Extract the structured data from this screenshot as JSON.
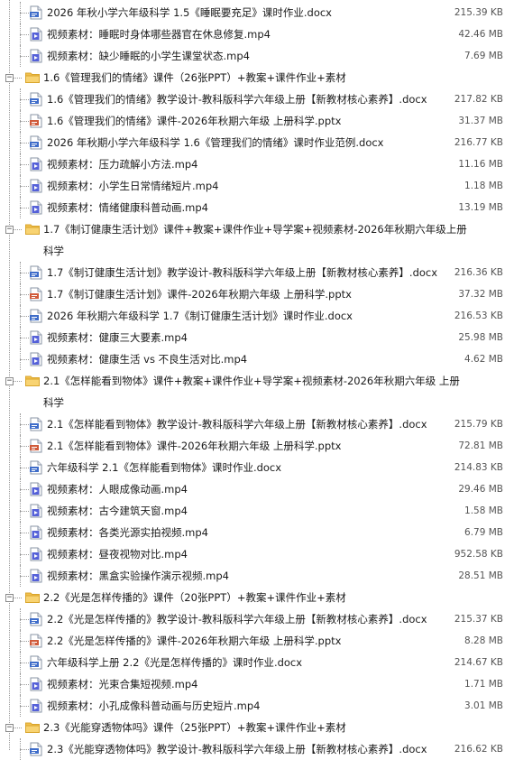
{
  "colors": {
    "doc": "#3f6dc9",
    "video": "#5561d8",
    "ppt": "#d05a3a",
    "folder": "#f2c14e"
  },
  "rows": [
    {
      "kind": "file",
      "icon": "doc-icon",
      "name": "2026 年秋小学六年级科学 1.5《睡眠要充足》课时作业.docx",
      "size": "215.39 KB"
    },
    {
      "kind": "file",
      "icon": "video-icon",
      "name": "视频素材：睡眠时身体哪些器官在休息修复.mp4",
      "size": "42.46 MB"
    },
    {
      "kind": "file",
      "icon": "video-icon",
      "name": "视频素材：缺少睡眠的小学生课堂状态.mp4",
      "size": "7.69 MB"
    },
    {
      "kind": "folder",
      "name": "1.6《管理我们的情绪》课件（26张PPT）+教案+课件作业+素材"
    },
    {
      "kind": "file",
      "icon": "doc-icon",
      "name": "1.6《管理我们的情绪》教学设计-教科版科学六年级上册【新教材核心素养】.docx",
      "size": "217.82 KB"
    },
    {
      "kind": "file",
      "icon": "ppt-icon",
      "name": "1.6《管理我们的情绪》课件-2026年秋期六年级 上册科学.pptx",
      "size": "31.37 MB"
    },
    {
      "kind": "file",
      "icon": "doc-icon",
      "name": "2026 年秋期小学六年级科学 1.6《管理我们的情绪》课时作业范例.docx",
      "size": "216.77 KB"
    },
    {
      "kind": "file",
      "icon": "video-icon",
      "name": "视频素材：压力疏解小方法.mp4",
      "size": "11.16 MB"
    },
    {
      "kind": "file",
      "icon": "video-icon",
      "name": "视频素材：小学生日常情绪短片.mp4",
      "size": "1.18 MB"
    },
    {
      "kind": "file",
      "icon": "video-icon",
      "name": "视频素材：情绪健康科普动画.mp4",
      "size": "13.19 MB"
    },
    {
      "kind": "folder",
      "name": "1.7《制订健康生活计划》课件+教案+课件作业+导学案+视频素材-2026年秋期六年级上册科学"
    },
    {
      "kind": "file",
      "icon": "doc-icon",
      "name": "1.7《制订健康生活计划》教学设计-教科版科学六年级上册【新教材核心素养】.docx",
      "size": "216.36 KB"
    },
    {
      "kind": "file",
      "icon": "ppt-icon",
      "name": "1.7《制订健康生活计划》课件-2026年秋期六年级 上册科学.pptx",
      "size": "37.32 MB"
    },
    {
      "kind": "file",
      "icon": "doc-icon",
      "name": "2026 年秋期六年级科学 1.7《制订健康生活计划》课时作业.docx",
      "size": "216.53 KB"
    },
    {
      "kind": "file",
      "icon": "video-icon",
      "name": "视频素材：健康三大要素.mp4",
      "size": "25.98 MB"
    },
    {
      "kind": "file",
      "icon": "video-icon",
      "name": "视频素材：健康生活 vs 不良生活对比.mp4",
      "size": "4.62 MB"
    },
    {
      "kind": "folder",
      "name": "2.1《怎样能看到物体》课件+教案+课件作业+导学案+视频素材-2026年秋期六年级 上册科学"
    },
    {
      "kind": "file",
      "icon": "doc-icon",
      "name": "2.1《怎样能看到物体》教学设计-教科版科学六年级上册【新教材核心素养】.docx",
      "size": "215.79 KB"
    },
    {
      "kind": "file",
      "icon": "ppt-icon",
      "name": "2.1《怎样能看到物体》课件-2026年秋期六年级 上册科学.pptx",
      "size": "72.81 MB"
    },
    {
      "kind": "file",
      "icon": "doc-icon",
      "name": "六年级科学 2.1《怎样能看到物体》课时作业.docx",
      "size": "214.83 KB"
    },
    {
      "kind": "file",
      "icon": "video-icon",
      "name": "视频素材：人眼成像动画.mp4",
      "size": "29.46 MB"
    },
    {
      "kind": "file",
      "icon": "video-icon",
      "name": "视频素材：古今建筑天窗.mp4",
      "size": "1.58 MB"
    },
    {
      "kind": "file",
      "icon": "video-icon",
      "name": "视频素材：各类光源实拍视频.mp4",
      "size": "6.79 MB"
    },
    {
      "kind": "file",
      "icon": "video-icon",
      "name": "视频素材：昼夜视物对比.mp4",
      "size": "952.58 KB"
    },
    {
      "kind": "file",
      "icon": "video-icon",
      "name": "视频素材：黑盒实验操作演示视频.mp4",
      "size": "28.51 MB"
    },
    {
      "kind": "folder",
      "name": "2.2《光是怎样传播的》课件（20张PPT）+教案+课件作业+素材"
    },
    {
      "kind": "file",
      "icon": "doc-icon",
      "name": "2.2《光是怎样传播的》教学设计-教科版科学六年级上册【新教材核心素养】.docx",
      "size": "215.37 KB"
    },
    {
      "kind": "file",
      "icon": "ppt-icon",
      "name": "2.2《光是怎样传播的》课件-2026年秋期六年级 上册科学.pptx",
      "size": "8.28 MB"
    },
    {
      "kind": "file",
      "icon": "doc-icon",
      "name": "六年级科学上册 2.2《光是怎样传播的》课时作业.docx",
      "size": "214.67 KB"
    },
    {
      "kind": "file",
      "icon": "video-icon",
      "name": "视频素材：光束合集短视频.mp4",
      "size": "1.71 MB"
    },
    {
      "kind": "file",
      "icon": "video-icon",
      "name": "视频素材：小孔成像科普动画与历史短片.mp4",
      "size": "3.01 MB"
    },
    {
      "kind": "folder",
      "name": "2.3《光能穿透物体吗》课件（25张PPT）+教案+课件作业+素材"
    },
    {
      "kind": "file",
      "icon": "doc-icon",
      "name": "2.3《光能穿透物体吗》教学设计-教科版科学六年级上册【新教材核心素养】.docx",
      "size": "216.62 KB"
    }
  ]
}
